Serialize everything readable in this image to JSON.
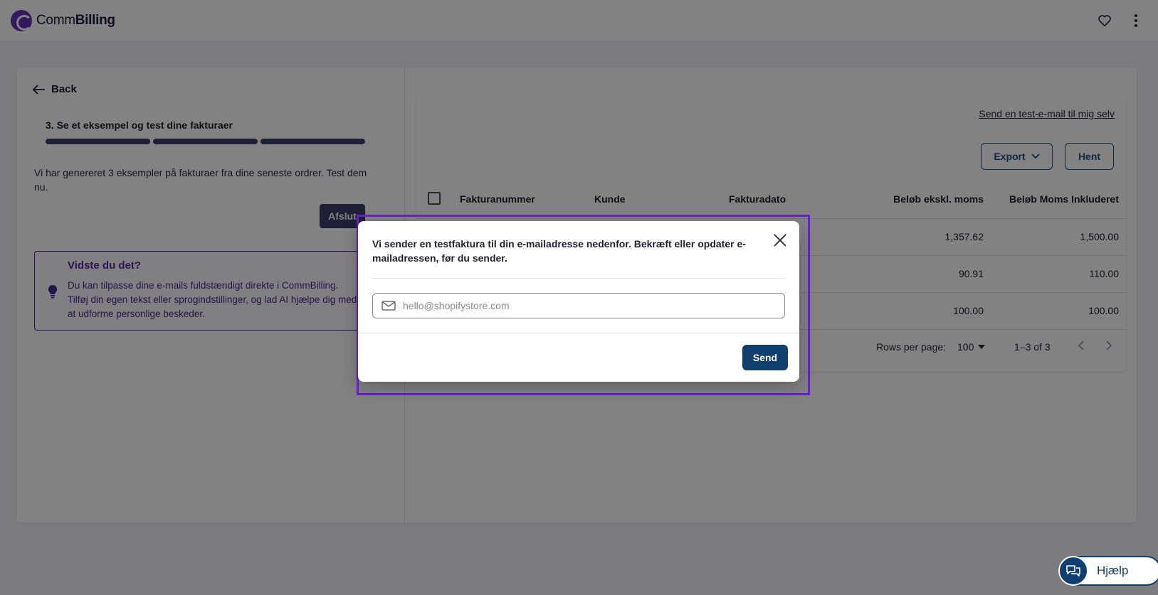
{
  "header": {
    "logo_comm": "Comm",
    "logo_billing": "Billing",
    "favorite_icon": "heart-icon",
    "menu_icon": "more-vertical-icon"
  },
  "left_panel": {
    "back_label": "Back",
    "step_title": "3. Se et eksempel og test dine fakturaer",
    "progress_segments": 3,
    "progress_completed": 3,
    "description": "Vi har genereret 3 eksempler på fakturaer fra dine seneste ordrer. Test dem nu.",
    "finish_label": "Afslut",
    "tip": {
      "title": "Vidste du det?",
      "text": "Du kan tilpasse dine e-mails fuldstændigt direkte i CommBilling. Tilføj din egen tekst eller sprogindstillinger, og lad AI hjælpe dig med at udforme personlige beskeder.",
      "icon": "lightbulb-icon"
    }
  },
  "table_card": {
    "test_link": "Send en test-e-mail til mig selv",
    "export_label": "Export",
    "hent_label": "Hent",
    "columns": [
      "Fakturanummer",
      "Kunde",
      "Fakturadato",
      "Beløb ekskl. moms",
      "Beløb Moms Inkluderet"
    ],
    "rows": [
      {
        "excl": "1,357.62",
        "incl": "1,500.00"
      },
      {
        "excl": "90.91",
        "incl": "110.00"
      },
      {
        "excl": "100.00",
        "incl": "100.00"
      }
    ],
    "pager": {
      "rows_label": "Rows per page:",
      "rows_value": "100",
      "range": "1–3 of 3"
    }
  },
  "modal": {
    "message": "Vi sender en testfaktura til din e-mailadresse nedenfor. Bekræft eller opdater e-mailadressen, før du sender.",
    "email_placeholder": "hello@shopifystore.com",
    "email_value": "",
    "send_label": "Send"
  },
  "help": {
    "label": "Hjælp",
    "icon": "chat-bubbles-icon"
  },
  "colors": {
    "primary": "#0f3f70",
    "accent_purple": "#6a1fd1",
    "progress": "#3a3f6b",
    "overlay": "rgba(0,0,0,0.49)"
  }
}
